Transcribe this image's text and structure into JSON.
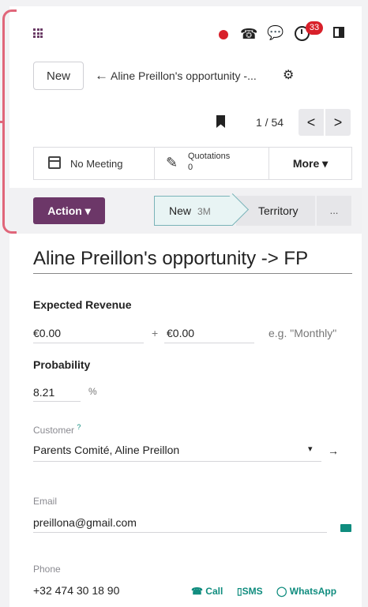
{
  "topbar": {
    "icons": [
      "apps-grid-icon",
      "record-icon",
      "phone-icon",
      "chat-icon",
      "activity-clock-icon",
      "panel-toggle-icon"
    ],
    "activity_badge": "33",
    "colors": {
      "record": "#d8202a",
      "brand": "#6c3768",
      "accent": "#0f8c7e"
    }
  },
  "breadcrumb": {
    "new_label": "New",
    "title": "Aline Preillon's opportunity -..."
  },
  "pager": {
    "text": "1 / 54",
    "prev": "<",
    "next": ">"
  },
  "smart_buttons": {
    "meeting": "No Meeting",
    "quotations_label": "Quotations",
    "quotations_count": "0",
    "more": "More ▾"
  },
  "statusbar": {
    "action": "Action ▾",
    "stages": [
      {
        "label": "New",
        "duration": "3M",
        "active": true
      },
      {
        "label": "Territory",
        "active": false
      },
      {
        "label": "...",
        "active": false
      }
    ]
  },
  "form": {
    "title": "Aline Preillon's opportunity -> FP",
    "expected_revenue_label": "Expected Revenue",
    "expected_revenue": "€0.00",
    "plus": "+",
    "recurring_revenue": "€0.00",
    "recurring_placeholder": "e.g. \"Monthly\"",
    "probability_label": "Probability",
    "probability": "8.21",
    "percent": "%",
    "customer_label": "Customer",
    "customer_help": "?",
    "customer": "Parents Comité, Aline Preillon",
    "email_label": "Email",
    "email": "preillona@gmail.com",
    "phone_label": "Phone",
    "phone": "+32 474 30 18 90",
    "call": "Call",
    "sms": "SMS",
    "whatsapp": "WhatsApp"
  }
}
